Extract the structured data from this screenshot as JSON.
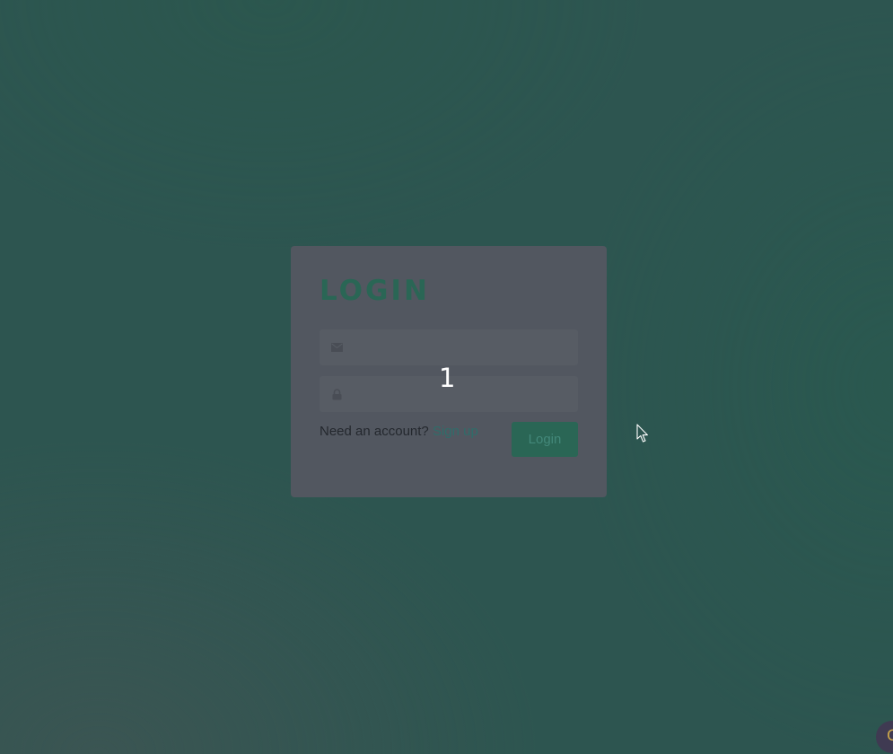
{
  "login": {
    "title": "LOGIN",
    "email": {
      "icon": "envelope-icon",
      "placeholder": "",
      "value": ""
    },
    "password": {
      "icon": "lock-icon",
      "placeholder": "",
      "value": ""
    },
    "need_account_text": "Need an account?",
    "signup_link": "Sign up",
    "login_button": "Login"
  },
  "overlay": {
    "number": "1"
  },
  "colors": {
    "background": "#2d5550",
    "card": "#525760",
    "accent": "#2a6655",
    "link": "#2f6d6a"
  }
}
